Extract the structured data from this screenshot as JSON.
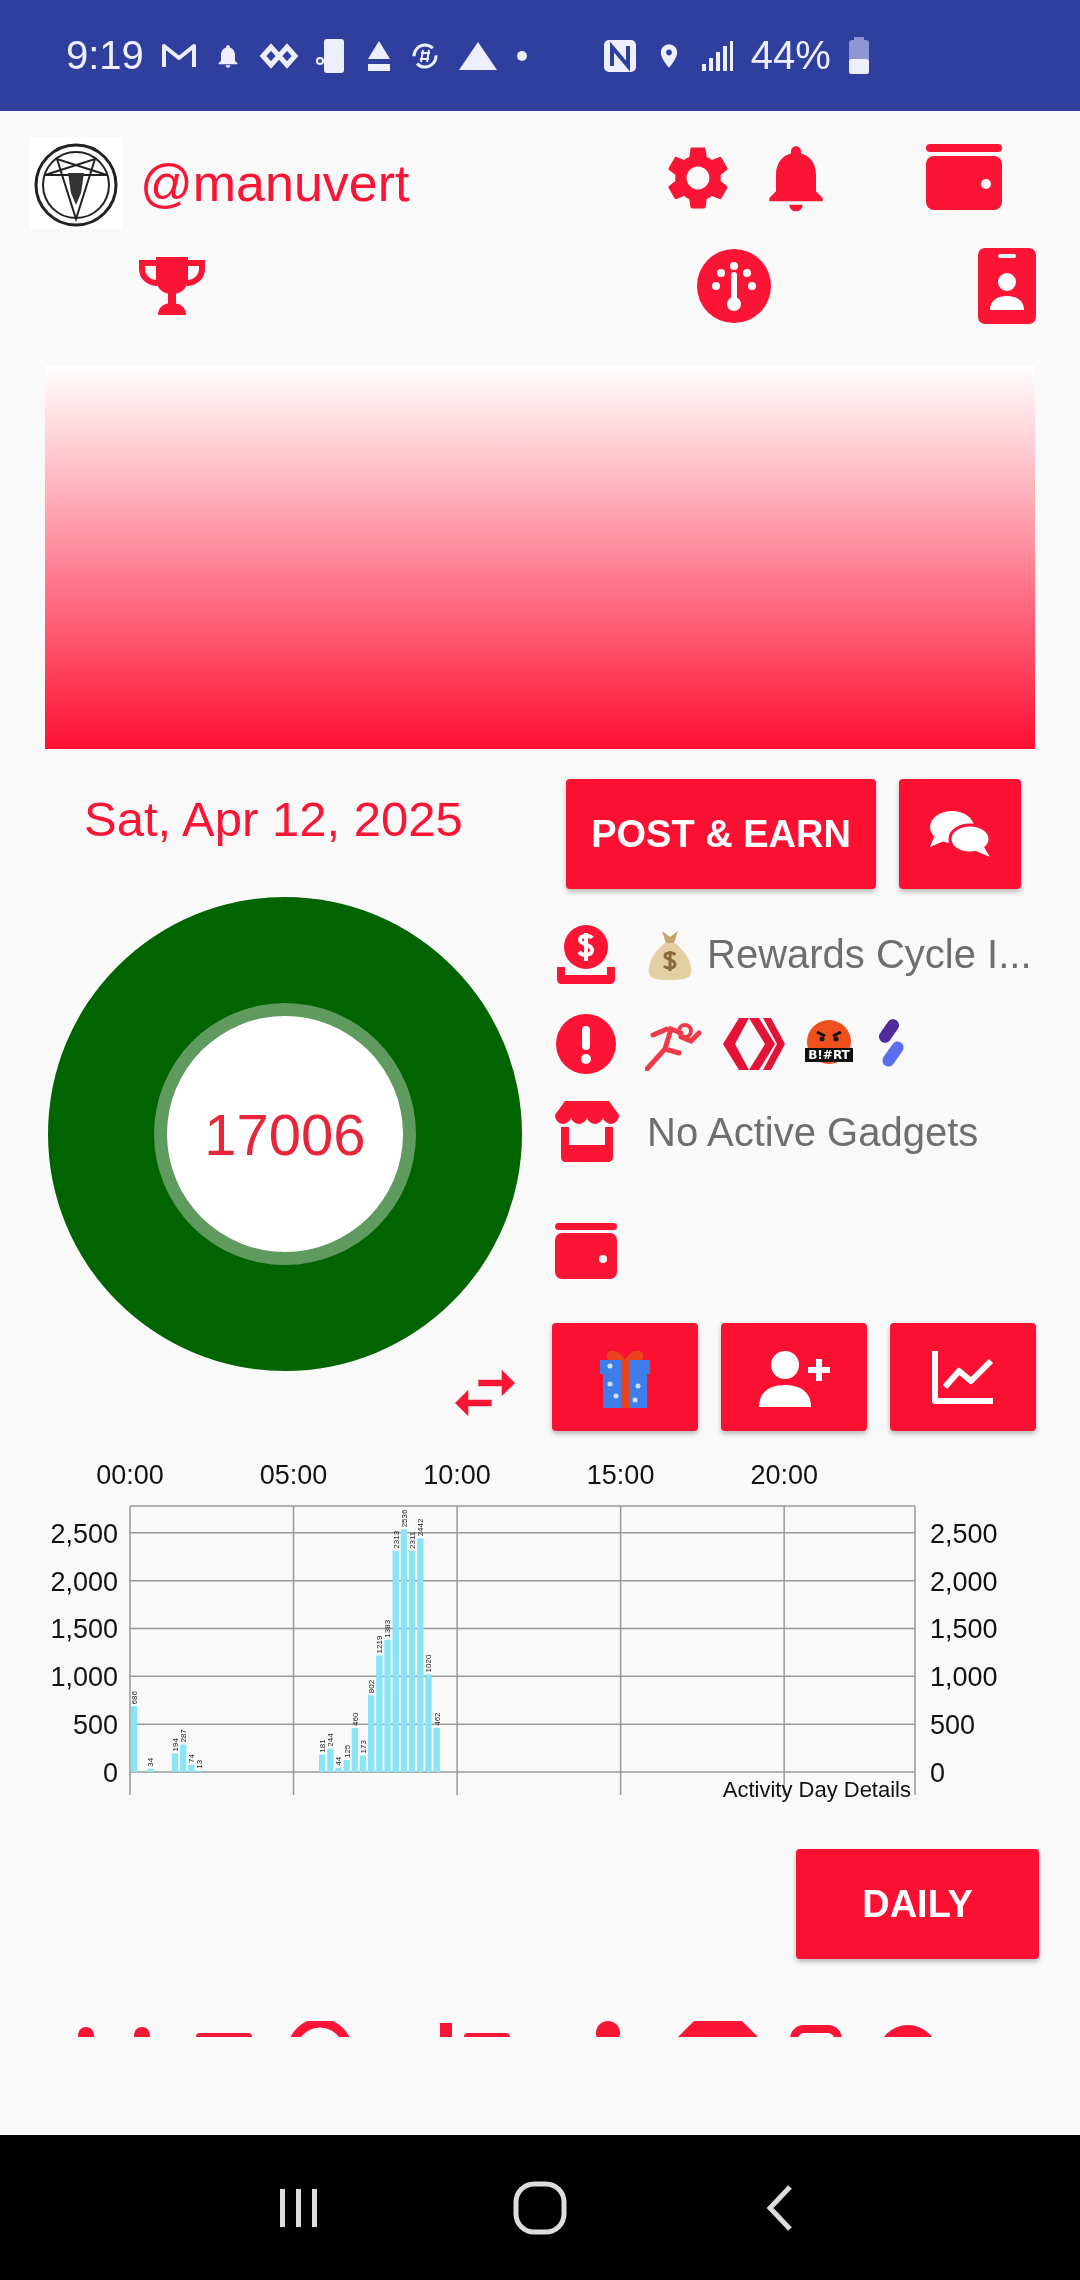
{
  "status_bar": {
    "time": "9:19",
    "battery": "44%"
  },
  "profile": {
    "handle": "@manuvert"
  },
  "date": "Sat, Apr 12, 2025",
  "post_button": "POST & EARN",
  "gauge": {
    "value": "17006"
  },
  "rewards": {
    "text": "Rewards Cycle I..."
  },
  "tokens": [
    {
      "kind": "runner"
    },
    {
      "kind": "hive"
    },
    {
      "kind": "bert",
      "label": "B!#RT"
    },
    {
      "kind": "splinter"
    }
  ],
  "gadgets": "No Active Gadgets",
  "activity_chart": {
    "chart_data": {
      "type": "bar",
      "title": "Activity Day Details",
      "x": [
        0,
        0.5,
        1.25,
        1.5,
        1.75,
        2,
        5.75,
        6,
        6.25,
        6.5,
        6.75,
        7,
        7.25,
        7.5,
        7.75,
        8,
        8.25,
        8.5,
        8.75,
        9,
        9.25
      ],
      "values": [
        686,
        34,
        194,
        287,
        74,
        13,
        181,
        244,
        44,
        125,
        460,
        173,
        802,
        1219,
        1383,
        2313,
        2536,
        2311,
        2442,
        1020,
        462
      ],
      "xlim": [
        0,
        24
      ],
      "ylim": [
        0,
        2780
      ],
      "xticks": [
        {
          "value": 0,
          "label": "00:00"
        },
        {
          "value": 5,
          "label": "05:00"
        },
        {
          "value": 10,
          "label": "10:00"
        },
        {
          "value": 15,
          "label": "15:00"
        },
        {
          "value": 20,
          "label": "20:00"
        }
      ],
      "yticks": [
        {
          "value": 0,
          "label": "0"
        },
        {
          "value": 500,
          "label": "500"
        },
        {
          "value": 1000,
          "label": "1,000"
        },
        {
          "value": 1500,
          "label": "1,500"
        },
        {
          "value": 2000,
          "label": "2,000"
        },
        {
          "value": 2500,
          "label": "2,500"
        }
      ],
      "grid": true,
      "data_labels": true
    }
  },
  "daily_button": "DAILY"
}
